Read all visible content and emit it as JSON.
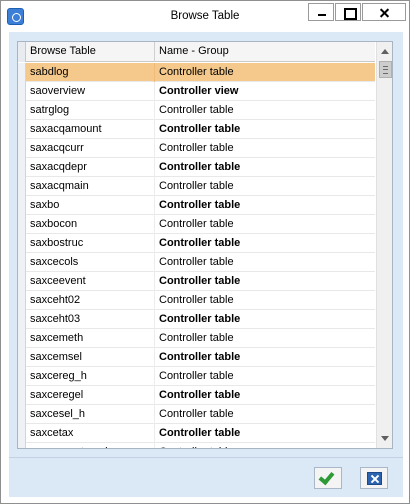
{
  "window": {
    "title": "Browse Table",
    "icon": "app-icon",
    "controls": [
      "minimize-icon",
      "maximize-icon",
      "close-icon"
    ]
  },
  "grid": {
    "columns": [
      "Browse Table",
      "Name - Group"
    ],
    "selected_row_color": "#f5c88c",
    "rows": [
      {
        "table": "sabdlog",
        "group": "Controller table",
        "bold": false,
        "selected": true
      },
      {
        "table": "saoverview",
        "group": "Controller view",
        "bold": true,
        "selected": false
      },
      {
        "table": "satrglog",
        "group": "Controller table",
        "bold": false,
        "selected": false
      },
      {
        "table": "saxacqamount",
        "group": "Controller table",
        "bold": true,
        "selected": false
      },
      {
        "table": "saxacqcurr",
        "group": "Controller table",
        "bold": false,
        "selected": false
      },
      {
        "table": "saxacqdepr",
        "group": "Controller table",
        "bold": true,
        "selected": false
      },
      {
        "table": "saxacqmain",
        "group": "Controller table",
        "bold": false,
        "selected": false
      },
      {
        "table": "saxbo",
        "group": "Controller table",
        "bold": true,
        "selected": false
      },
      {
        "table": "saxbocon",
        "group": "Controller table",
        "bold": false,
        "selected": false
      },
      {
        "table": "saxbostruc",
        "group": "Controller table",
        "bold": true,
        "selected": false
      },
      {
        "table": "saxcecols",
        "group": "Controller table",
        "bold": false,
        "selected": false
      },
      {
        "table": "saxceevent",
        "group": "Controller table",
        "bold": true,
        "selected": false
      },
      {
        "table": "saxceht02",
        "group": "Controller table",
        "bold": false,
        "selected": false
      },
      {
        "table": "saxceht03",
        "group": "Controller table",
        "bold": true,
        "selected": false
      },
      {
        "table": "saxcemeth",
        "group": "Controller table",
        "bold": false,
        "selected": false
      },
      {
        "table": "saxcemsel",
        "group": "Controller table",
        "bold": true,
        "selected": false
      },
      {
        "table": "saxcereg_h",
        "group": "Controller table",
        "bold": false,
        "selected": false
      },
      {
        "table": "saxceregel",
        "group": "Controller table",
        "bold": true,
        "selected": false
      },
      {
        "table": "saxcesel_h",
        "group": "Controller table",
        "bold": false,
        "selected": false
      },
      {
        "table": "saxcetax",
        "group": "Controller table",
        "bold": true,
        "selected": false
      },
      {
        "table": "saxcereg_tax_dummy",
        "group": "Controller table",
        "bold": false,
        "selected": false
      }
    ]
  },
  "footer": {
    "ok_icon": "check-icon",
    "cancel_icon": "cancel-icon"
  }
}
